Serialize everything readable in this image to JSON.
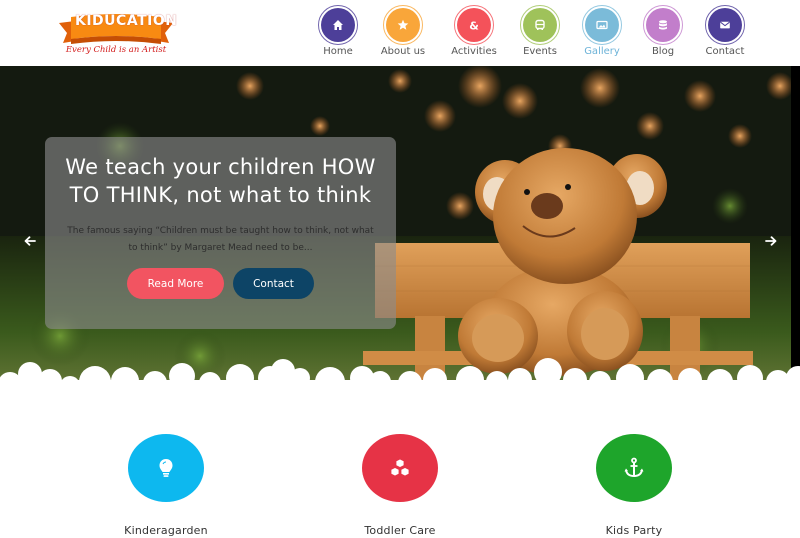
{
  "brand": {
    "name": "KIDUCATION",
    "tagline": "Every Child is an Artist"
  },
  "nav": {
    "items": [
      {
        "label": "Home",
        "icon": "home-icon",
        "color": "#4d3f99",
        "active": false
      },
      {
        "label": "About us",
        "icon": "star-icon",
        "color": "#f9a63a",
        "active": false
      },
      {
        "label": "Activities",
        "icon": "ampersand-icon",
        "color": "#f4525a",
        "active": false
      },
      {
        "label": "Events",
        "icon": "bus-icon",
        "color": "#9fc25a",
        "active": false
      },
      {
        "label": "Gallery",
        "icon": "image-icon",
        "color": "#7bbbd9",
        "active": true
      },
      {
        "label": "Blog",
        "icon": "database-icon",
        "color": "#c27ecb",
        "active": false
      },
      {
        "label": "Contact",
        "icon": "envelope-icon",
        "color": "#4d3f99",
        "active": false
      }
    ]
  },
  "hero": {
    "title": "We teach your children HOW TO THINK, not what to think",
    "description": "The famous saying “Children must be taught how to think, not what to think” by Margaret Mead need to be...",
    "read_more_label": "Read More",
    "contact_label": "Contact",
    "prev_icon": "arrow-left-icon",
    "next_icon": "arrow-right-icon"
  },
  "services": [
    {
      "label": "Kinderagarden",
      "icon": "lightbulb-icon",
      "color": "#0db8ef"
    },
    {
      "label": "Toddler Care",
      "icon": "cubes-icon",
      "color": "#e63346"
    },
    {
      "label": "Kids Party",
      "icon": "anchor-icon",
      "color": "#1ea52b"
    }
  ]
}
